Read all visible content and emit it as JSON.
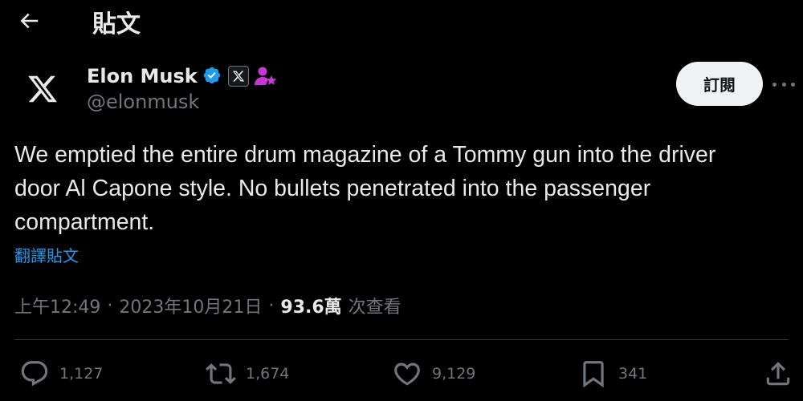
{
  "header": {
    "title": "貼文"
  },
  "author": {
    "name": "Elon Musk",
    "handle": "@elonmusk",
    "avatar_icon": "x-logo-icon",
    "verified_color": "#1d9bf0",
    "affiliate_color": "#c936d6"
  },
  "subscribe_label": "訂閱",
  "tweet": {
    "text": "We emptied the entire drum magazine of a Tommy gun into the driver\ndoor Al Capone style. No bullets penetrated into the passenger\ncompartment.",
    "translate_label": "翻譯貼文"
  },
  "meta": {
    "time": "上午12:49",
    "separator": "·",
    "date": "2023年10月21日",
    "views_count": "93.6萬",
    "views_label": "次查看"
  },
  "actions": {
    "replies": "1,127",
    "reposts": "1,674",
    "likes": "9,129",
    "bookmarks": "341"
  },
  "colors": {
    "background": "#000000",
    "text": "#e7e9ea",
    "muted": "#71767b",
    "link": "#1d9bf0"
  }
}
